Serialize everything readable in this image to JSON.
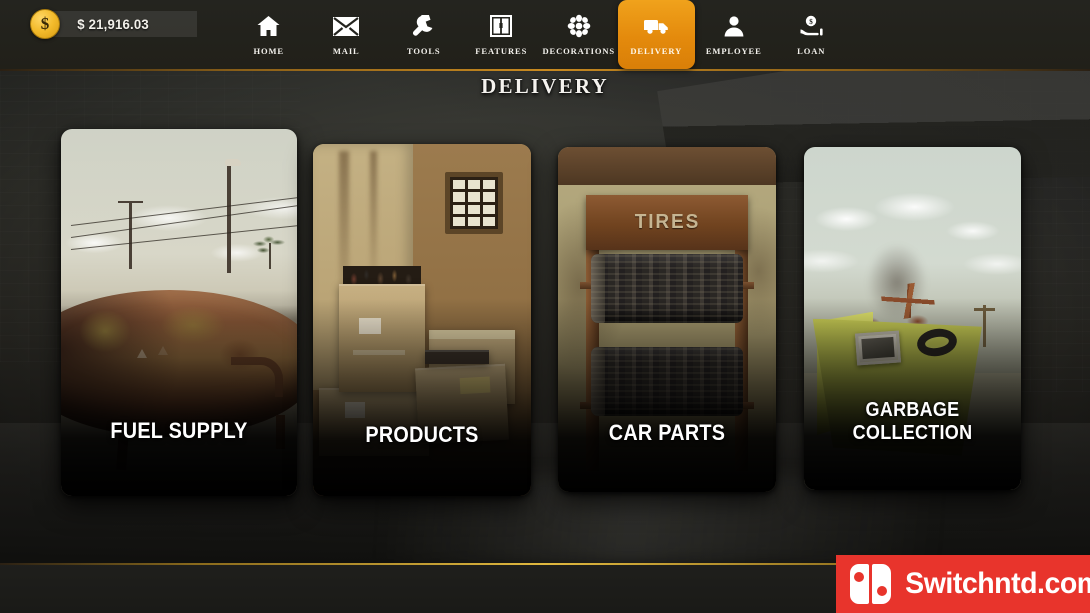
{
  "nav": {
    "items": [
      {
        "label": "HOME",
        "icon": "home-icon",
        "active": false
      },
      {
        "label": "MAIL",
        "icon": "mail-icon",
        "active": false
      },
      {
        "label": "TOOLS",
        "icon": "wrench-icon",
        "active": false
      },
      {
        "label": "FEATURES",
        "icon": "cabinet-icon",
        "active": false
      },
      {
        "label": "DECORATIONS",
        "icon": "flower-icon",
        "active": false
      },
      {
        "label": "DELIVERY",
        "icon": "truck-icon",
        "active": true
      },
      {
        "label": "EMPLOYEE",
        "icon": "person-icon",
        "active": false
      },
      {
        "label": "LOAN",
        "icon": "hand-coin-icon",
        "active": false
      }
    ]
  },
  "page": {
    "title": "DELIVERY"
  },
  "cards": [
    {
      "label": "FUEL SUPPLY",
      "art": "rusty-fuel-tank"
    },
    {
      "label": "PRODUCTS",
      "art": "cardboard-boxes"
    },
    {
      "label": "CAR PARTS",
      "art": "tire-rack",
      "sign_text": "TIRES"
    },
    {
      "label": "GARBAGE COLLECTION",
      "art": "yellow-skip-dumpster"
    }
  ],
  "status_bar": {
    "currency_symbol": "$",
    "money": "$ 21,916.03",
    "coin_glyph": "$"
  },
  "watermark": {
    "text": "Switchntd.com"
  },
  "colors": {
    "accent_orange": "#e8920e",
    "topbar": "#24241f",
    "gold_rule": "#c98a20",
    "coin_gold": "#f3bb2c",
    "watermark_red": "#e8342c"
  }
}
